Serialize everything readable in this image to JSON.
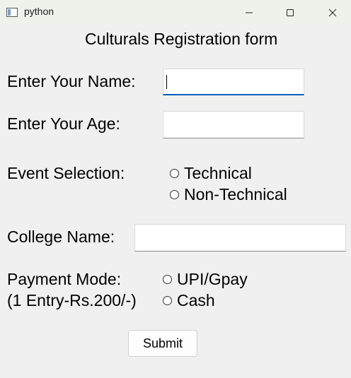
{
  "window": {
    "title": "python",
    "icon": "python-app-icon"
  },
  "form": {
    "title": "Culturals Registration form",
    "name_label": "Enter Your Name:",
    "name_value": "",
    "age_label": "Enter Your Age:",
    "age_value": "",
    "event_label": "Event Selection:",
    "event_options": [
      "Technical",
      "Non-Technical"
    ],
    "college_label": "College Name:",
    "college_value": "",
    "payment_label_line1": "Payment Mode:",
    "payment_label_line2": "(1 Entry-Rs.200/-)",
    "payment_options": [
      "UPI/Gpay",
      "Cash"
    ],
    "submit_label": "Submit"
  },
  "colors": {
    "window_bg": "#f0f0f0",
    "titlebar_bg": "#edf3ea",
    "focus_accent": "#005fb8"
  }
}
